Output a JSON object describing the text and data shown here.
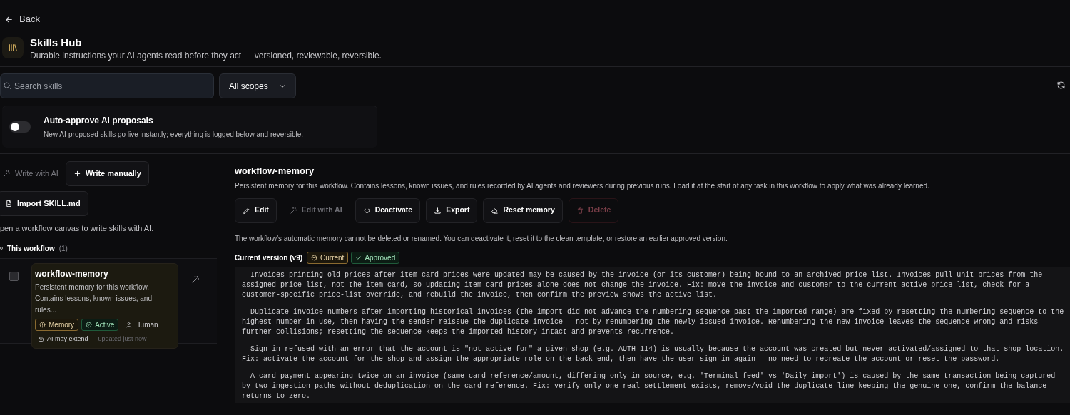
{
  "back": {
    "label": "Back"
  },
  "header": {
    "title": "Skills Hub",
    "subtitle": "Durable instructions your AI agents read before they act — versioned, reviewable, reversible."
  },
  "search": {
    "placeholder": "Search skills"
  },
  "scope_select": {
    "value": "All scopes"
  },
  "auto_approve": {
    "title": "Auto-approve AI proposals",
    "description": "New AI-proposed skills go live instantly; everything is logged below and reversible.",
    "on": false
  },
  "left_actions": [
    {
      "label": "Write with AI",
      "disabled": true
    },
    {
      "label": "Write manually",
      "disabled": false
    },
    {
      "label": "Import SKILL.md",
      "disabled": false
    }
  ],
  "hint": "pen a workflow canvas to write skills with AI.",
  "section": {
    "label": "This workflow",
    "count": "(1)"
  },
  "skills": [
    {
      "name": "workflow-memory",
      "description": "Persistent memory for this workflow. Contains lessons, known issues, and rules...",
      "checked": false,
      "selected": true,
      "badges": [
        {
          "label": "Memory",
          "kind": "highlight"
        },
        {
          "label": "Active",
          "kind": "success"
        },
        {
          "label": "Human",
          "kind": "plain"
        }
      ],
      "extend": "AI may extend",
      "updated": "updated just now"
    }
  ],
  "detail": {
    "title": "workflow-memory",
    "description": "Persistent memory for this workflow. Contains lessons, known issues, and rules recorded by AI agents and reviewers during previous runs. Load it at the start of any task in this workflow to apply what was already learned.",
    "actions": [
      {
        "label": "Edit",
        "disabled": false,
        "kind": "normal"
      },
      {
        "label": "Edit with AI",
        "disabled": true,
        "kind": "normal"
      },
      {
        "label": "Deactivate",
        "disabled": false,
        "kind": "normal"
      },
      {
        "label": "Export",
        "disabled": false,
        "kind": "normal"
      },
      {
        "label": "Reset memory",
        "disabled": false,
        "kind": "normal"
      },
      {
        "label": "Delete",
        "disabled": true,
        "kind": "danger"
      }
    ],
    "note": "The workflow’s automatic memory cannot be deleted or renamed. You can deactivate it, reset it to the clean template, or restore an earlier approved version.",
    "version": {
      "label": "Current version (v9)",
      "badges": [
        {
          "label": "Current",
          "kind": "highlight"
        },
        {
          "label": "Approved",
          "kind": "success"
        }
      ]
    },
    "content": [
      "- Invoices printing old prices after item-card prices were updated may be caused by the invoice (or its customer) being bound to an archived price list. Invoices pull unit prices from the assigned price list, not the item card, so updating item-card prices alone does not change the invoice. Fix: move the invoice and customer to the current active price list, check for a customer-specific price-list override, and rebuild the invoice, then confirm the preview shows the active list.",
      "- Duplicate invoice numbers after importing historical invoices (the import did not advance the numbering sequence past the imported range) are fixed by resetting the numbering sequence to the highest number in use, then having the sender reissue the duplicate invoice — not by renumbering the newly issued invoice. Renumbering the new invoice leaves the sequence wrong and risks further collisions; resetting the sequence keeps the imported history intact and prevents recurrence.",
      "- Sign-in refused with an error that the account is \"not active for\" a given shop (e.g. AUTH-114) is usually because the account was created but never activated/assigned to that shop location. Fix: activate the account for the shop and assign the appropriate role on the back end, then have the user sign in again — no need to recreate the account or reset the password.",
      "- A card payment appearing twice on an invoice (same card reference/amount, differing only in source, e.g. 'Terminal feed' vs 'Daily import') is caused by the same transaction being captured by two ingestion paths without deduplication on the card reference. Fix: verify only one real settlement exists, remove/void the duplicate line keeping the genuine one, confirm the balance returns to zero."
    ]
  }
}
